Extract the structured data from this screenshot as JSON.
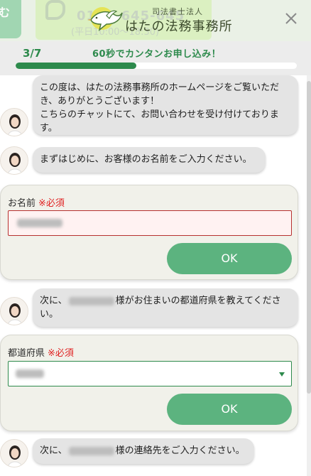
{
  "background_header": {
    "phone_number": "0120-645-645",
    "hours": "(平日10:00～18:30)",
    "left_tab_text": "む"
  },
  "header": {
    "logo_sub": "司法書士法人",
    "logo_main": "はたの法務事務所",
    "close_icon": "close-icon"
  },
  "progress": {
    "step": "3/7",
    "promo": "60秒でカンタンお申し込み！",
    "fraction": 0.43
  },
  "messages": [
    {
      "text": "この度は、はたの法務事務所のホームページをご覧いただき、ありがとうございます！\nこちらのチャットにて、お問い合わせを受け付けております。"
    },
    {
      "text": "まずはじめに、お客様のお名前をご入力ください。"
    },
    {
      "prefix": "次に、",
      "suffix": "様がお住まいの都道府県を教えてください。"
    },
    {
      "prefix": "次に、",
      "suffix": "様の連絡先をご入力ください。"
    }
  ],
  "name_form": {
    "label": "お名前",
    "required": "※必須",
    "ok": "OK"
  },
  "pref_form": {
    "label": "都道府県",
    "required": "※必須",
    "ok": "OK"
  },
  "colors": {
    "accent": "#2d8a4c",
    "ok_button": "#5cb37f",
    "required": "#e02020"
  }
}
